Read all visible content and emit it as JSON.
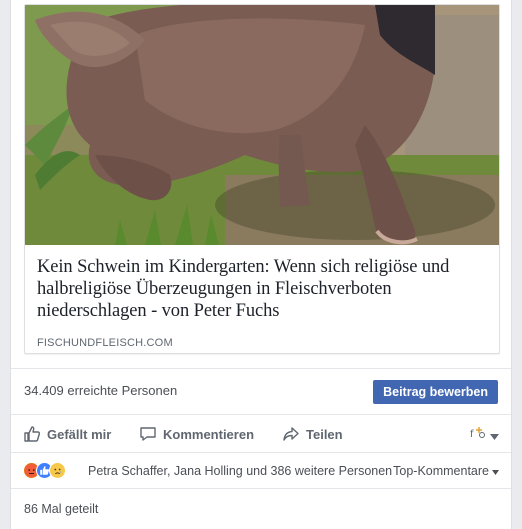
{
  "link_preview": {
    "image_alt": "Schwein im Gras",
    "headline": "Kein Schwein im Kindergarten: Wenn sich religiöse und halbreligiöse Überzeugungen in Fleischverboten niederschlagen - von Peter Fuchs",
    "domain": "FISCHUNDFLEISCH.COM"
  },
  "reach": {
    "text": "34.409 erreichte Personen",
    "boost_label": "Beitrag bewerben"
  },
  "actions": {
    "like_label": "Gefällt mir",
    "comment_label": "Kommentieren",
    "share_label": "Teilen",
    "like_icon": "thumbs-up-icon",
    "comment_icon": "speech-bubble-icon",
    "share_icon": "share-arrow-icon"
  },
  "reactions": {
    "icons": [
      "angry-reaction-icon",
      "like-reaction-icon",
      "sad-reaction-icon"
    ],
    "names_text": "Petra Schaffer, Jana Holling und 386 weitere Personen",
    "sort_label": "Top-Kommentare"
  },
  "shares": {
    "text": "86 Mal geteilt"
  },
  "colors": {
    "brand_blue": "#4267b2",
    "text_dark": "#1d2129",
    "text_gray": "#606770",
    "border": "#dddfe2",
    "background": "#e9ebee"
  }
}
